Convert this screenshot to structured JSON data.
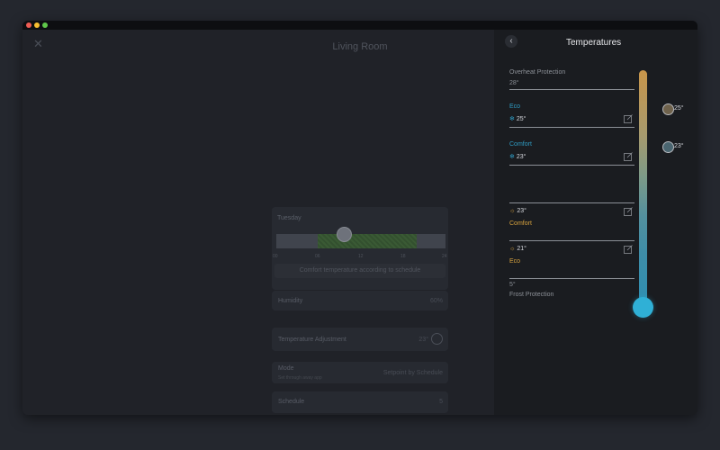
{
  "main": {
    "title": "Living Room",
    "schedule": {
      "day": "Tuesday",
      "ticks": [
        "00",
        "06",
        "12",
        "18",
        "24"
      ],
      "note": "Comfort temperature according to schedule"
    },
    "humidity": {
      "label": "Humidity",
      "value": "60%"
    },
    "temperature_adjustment": {
      "label": "Temperature Adjustment",
      "value": "23°"
    },
    "mode": {
      "label": "Mode",
      "subtitle": "Set through away app",
      "value": "Setpoint by Schedule"
    },
    "schedule_row": {
      "label": "Schedule",
      "value": "5"
    }
  },
  "panel": {
    "title": "Temperatures",
    "overheat": {
      "label": "Overheat Protection",
      "value": "28°"
    },
    "eco_cool": {
      "label": "Eco",
      "value": "25°"
    },
    "comfort_cool": {
      "label": "Comfort",
      "value": "23°"
    },
    "comfort_heat": {
      "label": "Comfort",
      "value": "23°"
    },
    "eco_heat": {
      "label": "Eco",
      "value": "21°"
    },
    "frost": {
      "label": "Frost Protection",
      "value": "5°"
    },
    "markers": [
      {
        "icon": "home-icon",
        "value": "25°"
      },
      {
        "icon": "leaf-icon",
        "value": "23°"
      }
    ]
  },
  "colors": {
    "accent_blue": "#2f9bc2",
    "accent_orange": "#d7a23e",
    "thermo_bulb": "#2fb0d6"
  }
}
